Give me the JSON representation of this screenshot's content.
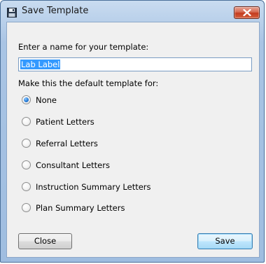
{
  "window": {
    "title": "Save Template"
  },
  "form": {
    "name_label": "Enter a name for your template:",
    "name_value": "Lab Label",
    "default_label": "Make this the default template for:",
    "options": [
      {
        "label": "None",
        "checked": true
      },
      {
        "label": "Patient Letters",
        "checked": false
      },
      {
        "label": "Referral Letters",
        "checked": false
      },
      {
        "label": "Consultant Letters",
        "checked": false
      },
      {
        "label": "Instruction Summary Letters",
        "checked": false
      },
      {
        "label": "Plan Summary Letters",
        "checked": false
      }
    ]
  },
  "buttons": {
    "close_label": "Close",
    "save_label": "Save"
  }
}
